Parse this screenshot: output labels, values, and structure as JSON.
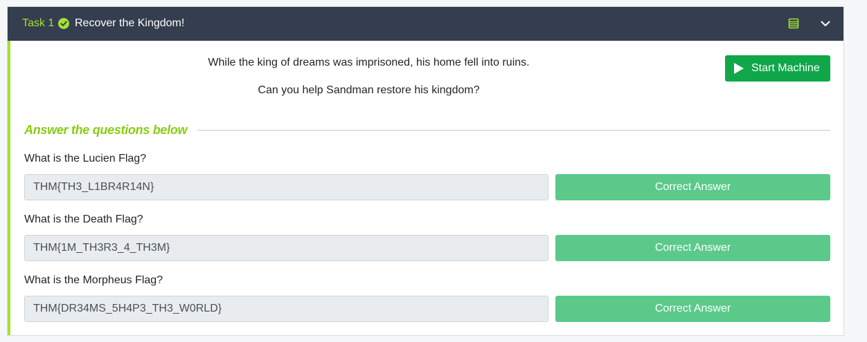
{
  "task": {
    "number_label": "Task 1",
    "title": "Recover the Kingdom!",
    "icons": {
      "complete": "check-circle-icon",
      "notes": "notes-icon",
      "collapse": "chevron-down-icon"
    }
  },
  "description": {
    "line1": "While the king of dreams was imprisoned, his home fell into ruins.",
    "line2": "Can you help Sandman restore his kingdom?"
  },
  "start_machine": {
    "label": "Start Machine",
    "icon": "play-icon"
  },
  "answers_heading": "Answer the questions below",
  "questions": [
    {
      "question": "What is the Lucien Flag?",
      "answer": "THM{TH3_L1BR4R14N}",
      "button": "Correct Answer"
    },
    {
      "question": "What is the Death Flag?",
      "answer": "THM{1M_TH3R3_4_TH3M}",
      "button": "Correct Answer"
    },
    {
      "question": "What is the Morpheus Flag?",
      "answer": "THM{DR34MS_5H4P3_TH3_W0RLD}",
      "button": "Correct Answer"
    }
  ],
  "colors": {
    "header_bg": "#343e4f",
    "accent_green": "#a4e132",
    "heading_green": "#88cc14",
    "start_button": "#10a74b",
    "correct_button": "#5bc98a"
  }
}
